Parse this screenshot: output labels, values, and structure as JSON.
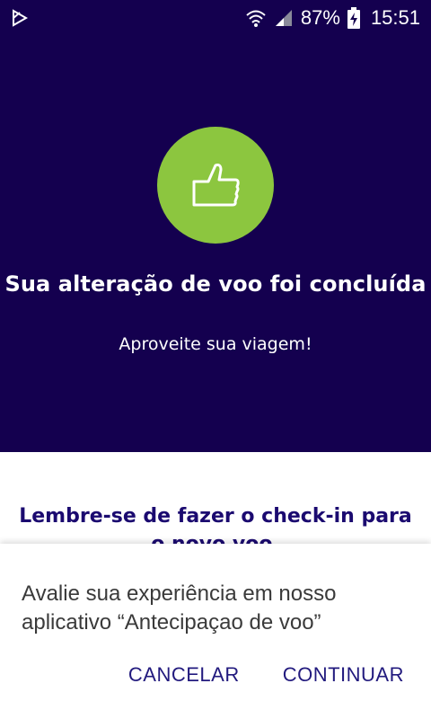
{
  "status_bar": {
    "battery_percent": "87%",
    "time": "15:51",
    "icons": [
      "play-store-icon",
      "wifi-icon",
      "signal-icon",
      "battery-charging-icon"
    ]
  },
  "hero": {
    "icon": "thumbs-up-icon",
    "title": "Sua alteração de voo foi concluída",
    "subtitle": "Aproveite sua viagem!",
    "background_color": "#14004f",
    "icon_circle_color": "#8cc63f"
  },
  "reminder": {
    "text": "Lembre-se de fazer o check-in para o novo voo."
  },
  "dialog": {
    "message": "Avalie sua experiência em nosso aplicativo “Antecipaçao de voo”",
    "cancel_label": "CANCELAR",
    "continue_label": "CONTINUAR"
  }
}
